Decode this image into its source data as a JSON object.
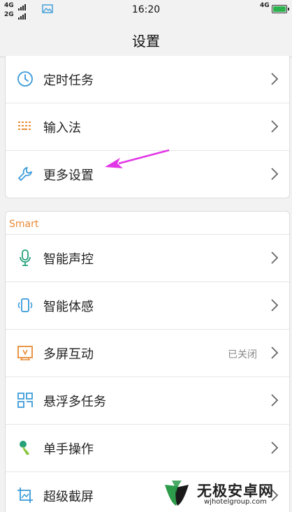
{
  "statusbar": {
    "sim1": "4G",
    "sim2": "2G",
    "time": "16:20",
    "network": "4G",
    "battery_level": 1.0
  },
  "header": {
    "title": "设置"
  },
  "group1": {
    "items": [
      {
        "label": "定时任务",
        "icon": "clock-icon"
      },
      {
        "label": "输入法",
        "icon": "keyboard-icon"
      },
      {
        "label": "更多设置",
        "icon": "wrench-icon"
      }
    ]
  },
  "group2": {
    "section_title": "Smart",
    "items": [
      {
        "label": "智能声控",
        "icon": "microphone-icon"
      },
      {
        "label": "智能体感",
        "icon": "phone-motion-icon"
      },
      {
        "label": "多屏互动",
        "icon": "multiscreen-icon",
        "status": "已关闭"
      },
      {
        "label": "悬浮多任务",
        "icon": "floating-window-icon"
      },
      {
        "label": "单手操作",
        "icon": "one-hand-icon"
      },
      {
        "label": "超级截屏",
        "icon": "screenshot-icon"
      }
    ]
  },
  "watermark": {
    "brand": "无极安卓网",
    "url": "wjhotelgroup.com"
  },
  "colors": {
    "accent_orange": "#e88a35",
    "icon_blue": "#3a9ad9",
    "icon_green": "#26a17a",
    "arrow_magenta": "#e236e6",
    "battery_green": "#2bb24c"
  }
}
